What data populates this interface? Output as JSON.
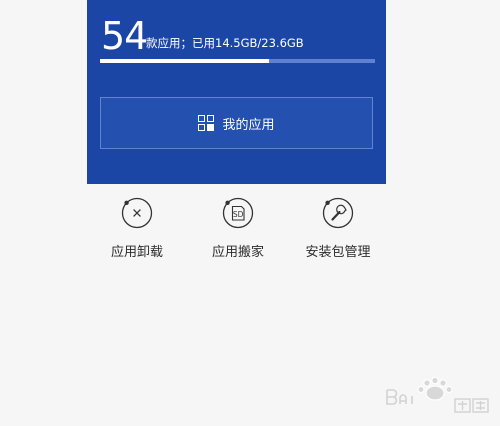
{
  "summary": {
    "app_count": "54",
    "text": "款应用；已用14.5GB/23.6GB",
    "storage_used_fraction": 0.614
  },
  "my_apps": {
    "label": "我的应用",
    "icon": "grid-icon"
  },
  "tools": [
    {
      "label": "应用卸载",
      "icon": "uninstall-x-icon"
    },
    {
      "label": "应用搬家",
      "icon": "sd-card-icon"
    },
    {
      "label": "安装包管理",
      "icon": "wrench-icon"
    }
  ],
  "watermark": {
    "icon": "baidu-paw-icon"
  },
  "colors": {
    "card": "#1c46a6",
    "track": "#5f82d0",
    "icon_stroke": "#333333",
    "page_bg": "#f6f6f6"
  }
}
